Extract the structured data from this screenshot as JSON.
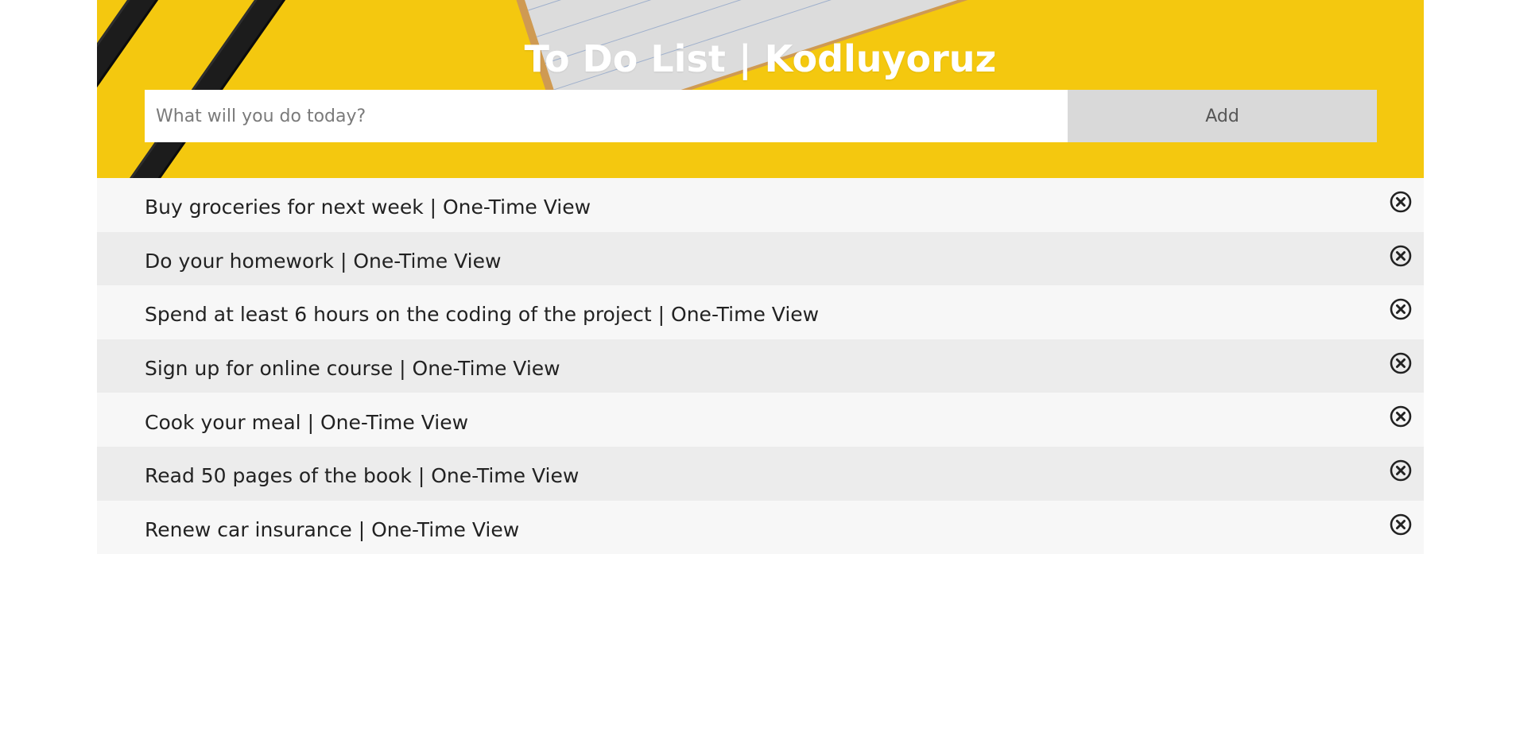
{
  "header": {
    "title": "To Do List | Kodluyoruz",
    "input_placeholder": "What will you do today?",
    "add_label": "Add",
    "background_color": "#f4c80f"
  },
  "tasks": [
    {
      "text": "Buy groceries for next week | One-Time View",
      "icon": "close-circle-icon"
    },
    {
      "text": "Do your homework | One-Time View",
      "icon": "close-circle-icon"
    },
    {
      "text": "Spend at least 6 hours on the coding of the project | One-Time View",
      "icon": "close-circle-icon"
    },
    {
      "text": "Sign up for online course | One-Time View",
      "icon": "close-circle-icon"
    },
    {
      "text": "Cook your meal | One-Time View",
      "icon": "close-circle-icon"
    },
    {
      "text": "Read 50 pages of the book | One-Time View",
      "icon": "close-circle-icon"
    },
    {
      "text": "Renew car insurance | One-Time View",
      "icon": "close-circle-icon"
    }
  ]
}
